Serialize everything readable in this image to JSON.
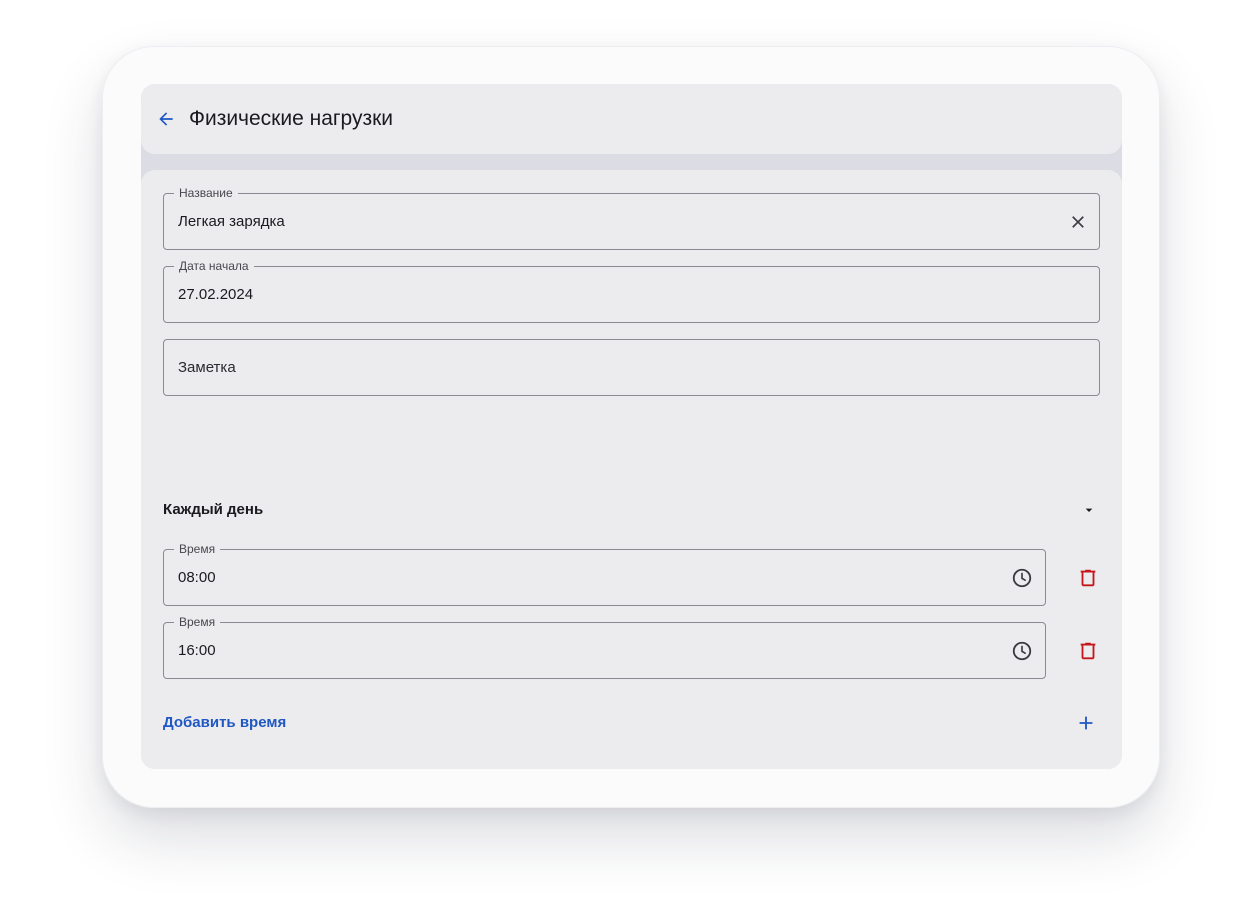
{
  "appbar": {
    "title": "Физические нагрузки",
    "back_icon": "arrow-back-icon"
  },
  "form": {
    "name_field": {
      "label": "Название",
      "value": "Легкая зарядка",
      "clear_icon": "close-icon"
    },
    "start_date_field": {
      "label": "Дата начала",
      "value": "27.02.2024"
    },
    "note_field": {
      "placeholder": "Заметка",
      "value": ""
    },
    "repeat": {
      "value": "Каждый день",
      "icon": "dropdown-arrow-icon"
    },
    "times": [
      {
        "label": "Время",
        "value": "08:00",
        "icon": "clock-icon",
        "delete_icon": "trash-icon"
      },
      {
        "label": "Время",
        "value": "16:00",
        "icon": "clock-icon",
        "delete_icon": "trash-icon"
      }
    ],
    "add_time": {
      "label": "Добавить время",
      "icon": "plus-icon"
    }
  },
  "colors": {
    "accent": "#1f57c3",
    "danger": "#c4161c",
    "surface": "#ececef",
    "outline": "#8a8a92"
  }
}
